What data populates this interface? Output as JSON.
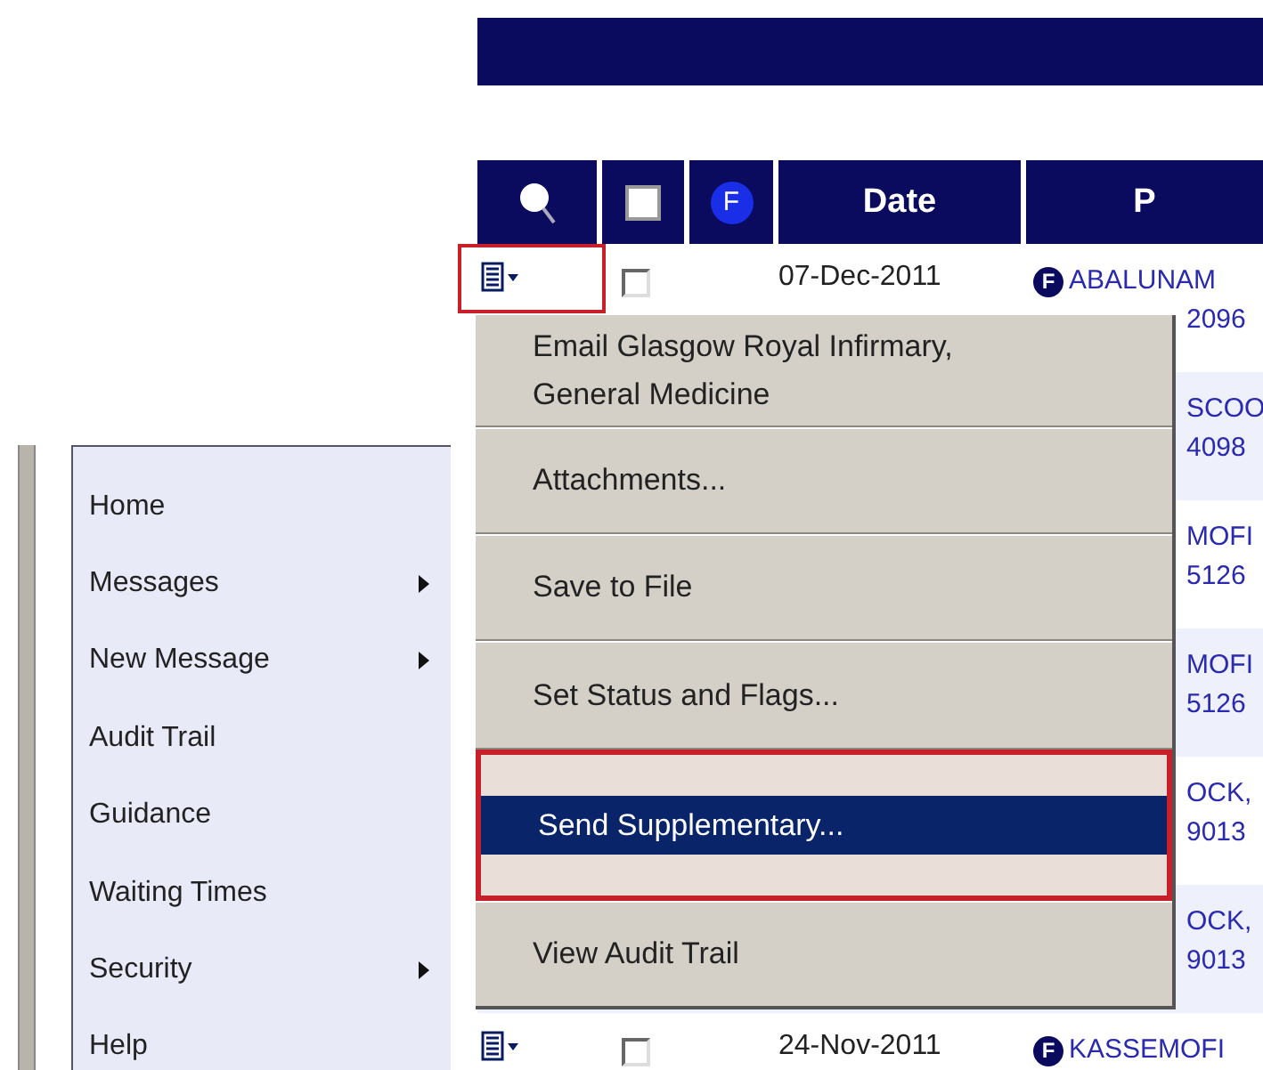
{
  "table": {
    "columns": [
      {
        "kind": "search"
      },
      {
        "kind": "checkbox",
        "checked": false
      },
      {
        "kind": "flag",
        "label": "F"
      },
      {
        "kind": "text",
        "label": "Date"
      },
      {
        "kind": "text",
        "label": "P"
      }
    ],
    "rows": [
      {
        "kind": "full",
        "highlighted": true,
        "checked": false,
        "date": "07-Dec-2011",
        "flag": "F",
        "name": "ABALUNAM",
        "number": "2096"
      },
      {
        "kind": "covered",
        "name": "SCOO",
        "number": "4098"
      },
      {
        "kind": "covered",
        "name": "MOFI",
        "number": "5126"
      },
      {
        "kind": "covered",
        "name": "MOFI",
        "number": "5126"
      },
      {
        "kind": "covered",
        "name": "OCK,",
        "number": "9013"
      },
      {
        "kind": "covered",
        "name": "OCK,",
        "number": "9013"
      },
      {
        "kind": "full",
        "highlighted": false,
        "checked": false,
        "date": "24-Nov-2011",
        "flag": "F",
        "name": "KASSEMOFI"
      }
    ]
  },
  "context_menu": {
    "items": [
      {
        "label": "Email Glasgow Royal Infirmary,\nGeneral Medicine",
        "selected": false
      },
      {
        "label": "Attachments...",
        "selected": false
      },
      {
        "label": "Save to File",
        "selected": false
      },
      {
        "label": "Set Status and Flags...",
        "selected": false
      },
      {
        "label": "Send Supplementary...",
        "selected": true
      },
      {
        "label": "View Audit Trail",
        "selected": false
      }
    ]
  },
  "sidebar": {
    "items": [
      {
        "label": "Home",
        "submenu": false
      },
      {
        "label": "Messages",
        "submenu": true
      },
      {
        "label": "New Message",
        "submenu": true
      },
      {
        "label": "Audit Trail",
        "submenu": false
      },
      {
        "label": "Guidance",
        "submenu": false
      },
      {
        "label": "Waiting Times",
        "submenu": false
      },
      {
        "label": "Security",
        "submenu": true
      },
      {
        "label": "Help",
        "submenu": false
      }
    ]
  }
}
